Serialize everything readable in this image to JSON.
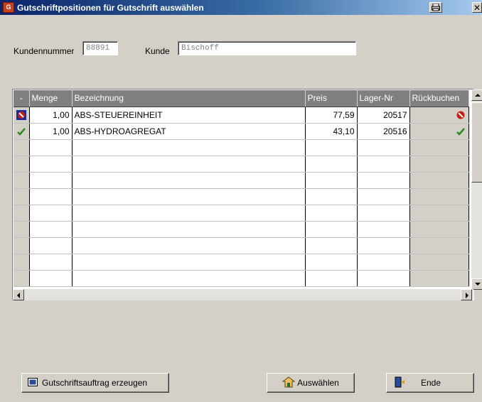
{
  "window": {
    "title": "Gutschriftpositionen für Gutschrift auswählen",
    "app_icon_text": "G"
  },
  "header": {
    "kundennummer_label": "Kundennummer",
    "kundennummer_value": "88891",
    "kunde_label": "Kunde",
    "kunde_value": "Bischoff"
  },
  "grid": {
    "columns": [
      "-",
      "Menge",
      "Bezeichnung",
      "Preis",
      "Lager-Nr",
      "Rückbuchen"
    ],
    "rows": [
      {
        "selector": "cancel-icon",
        "menge": "1,00",
        "bezeichnung": "ABS-STEUEREINHEIT",
        "preis": "77,59",
        "lager_nr": "20517",
        "rueckbuchen": "cancel-icon"
      },
      {
        "selector": "check-icon",
        "menge": "1,00",
        "bezeichnung": "ABS-HYDROAGREGAT",
        "preis": "43,10",
        "lager_nr": "20516",
        "rueckbuchen": "check-icon"
      }
    ],
    "empty_rows": 9
  },
  "buttons": {
    "create_label": "Gutschriftsauftrag erzeugen",
    "select_label": "Auswählen",
    "end_label": "Ende"
  },
  "colors": {
    "titlebar_start": "#0a246a",
    "header_bg": "#808080",
    "cancel_red": "#c81e0c",
    "check_green": "#2e8b1e"
  }
}
